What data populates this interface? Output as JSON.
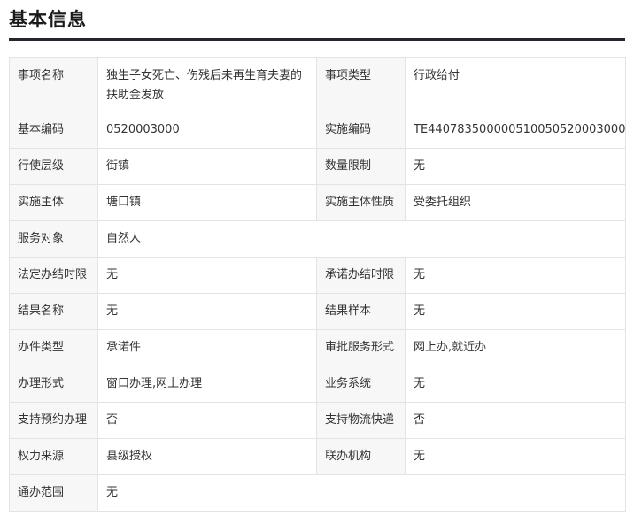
{
  "section": {
    "title": "基本信息"
  },
  "rows": [
    {
      "l1": "事项名称",
      "v1": "独生子女死亡、伤残后未再生育夫妻的扶助金发放",
      "l2": "事项类型",
      "v2": "行政给付"
    },
    {
      "l1": "基本编码",
      "v1": "0520003000",
      "l2": "实施编码",
      "v2": "TE440783500000510050520003000"
    },
    {
      "l1": "行使层级",
      "v1": "街镇",
      "l2": "数量限制",
      "v2": "无"
    },
    {
      "l1": "实施主体",
      "v1": "塘口镇",
      "l2": "实施主体性质",
      "v2": "受委托组织"
    },
    {
      "l1": "服务对象",
      "v1": "自然人"
    },
    {
      "l1": "法定办结时限",
      "v1": "无",
      "l2": "承诺办结时限",
      "v2": "无"
    },
    {
      "l1": "结果名称",
      "v1": "无",
      "l2": "结果样本",
      "v2": "无"
    },
    {
      "l1": "办件类型",
      "v1": "承诺件",
      "l2": "审批服务形式",
      "v2": "网上办,就近办"
    },
    {
      "l1": "办理形式",
      "v1": "窗口办理,网上办理",
      "l2": "业务系统",
      "v2": "无"
    },
    {
      "l1": "支持预约办理",
      "v1": "否",
      "l2": "支持物流快递",
      "v2": "否"
    },
    {
      "l1": "权力来源",
      "v1": "县级授权",
      "l2": "联办机构",
      "v2": "无"
    },
    {
      "l1": "通办范围",
      "v1": "无"
    }
  ]
}
